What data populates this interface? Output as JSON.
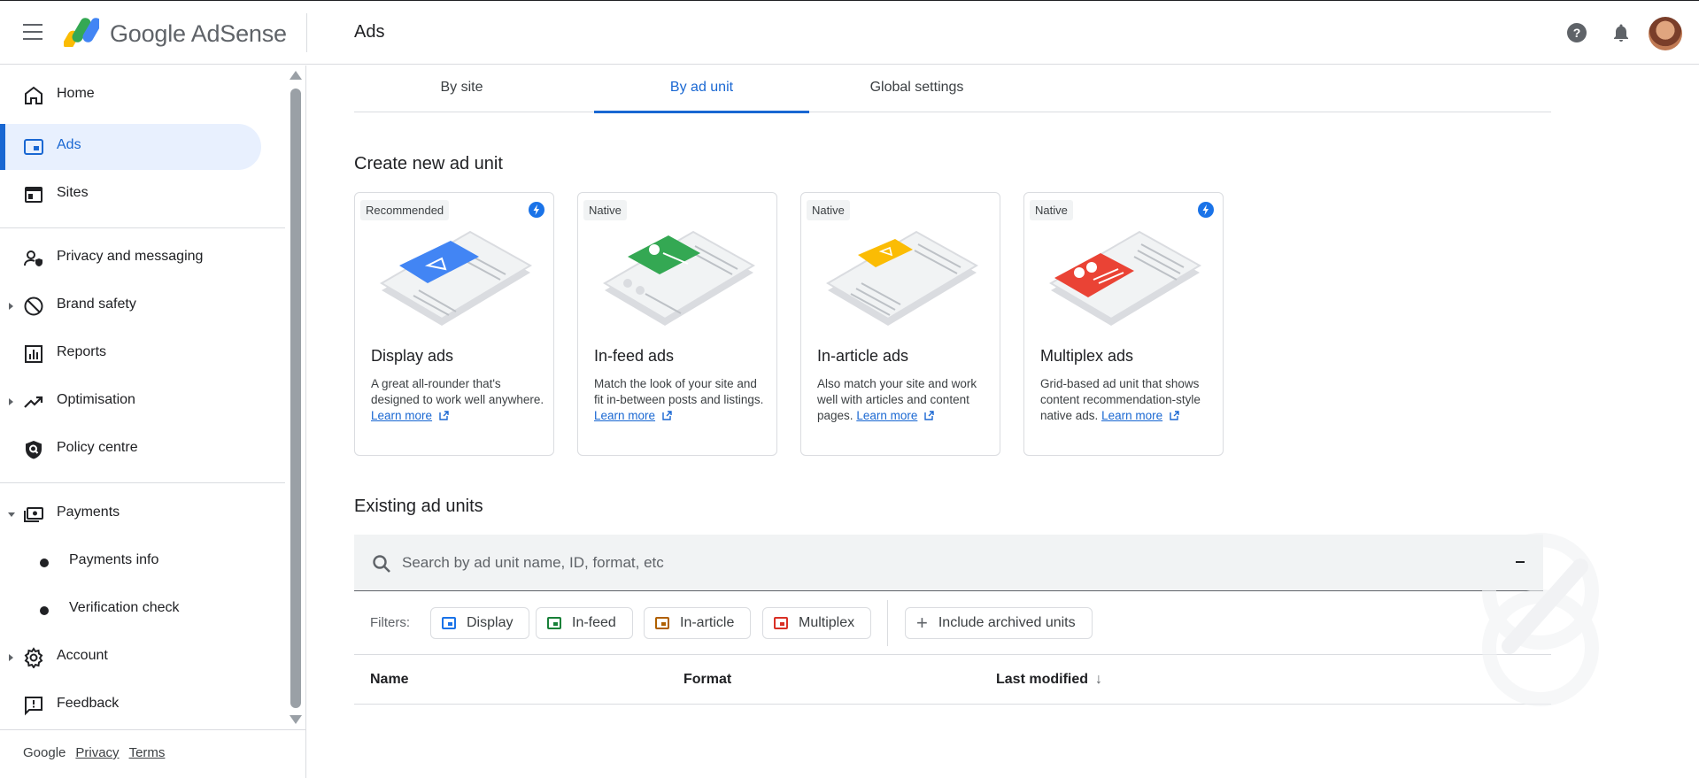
{
  "header": {
    "brand_prefix": "Google",
    "brand_name": "AdSense",
    "page_title": "Ads",
    "icons": [
      "menu-icon",
      "adsense-logo",
      "help-icon",
      "bell-icon"
    ]
  },
  "sidebar": {
    "items": [
      {
        "label": "Home",
        "icon": "home-icon"
      },
      {
        "label": "Ads",
        "icon": "ads-icon",
        "active": true
      },
      {
        "label": "Sites",
        "icon": "sites-icon"
      },
      {
        "label": "Privacy and messaging",
        "icon": "privacy-icon"
      },
      {
        "label": "Brand safety",
        "icon": "block-icon"
      },
      {
        "label": "Reports",
        "icon": "bar-chart-icon"
      },
      {
        "label": "Optimisation",
        "icon": "trending-up-icon"
      },
      {
        "label": "Policy centre",
        "icon": "shield-search-icon"
      },
      {
        "label": "Payments",
        "icon": "payments-icon"
      },
      {
        "label": "Payments info"
      },
      {
        "label": "Verification check"
      },
      {
        "label": "Account",
        "icon": "gear-icon"
      },
      {
        "label": "Feedback",
        "icon": "feedback-icon"
      }
    ],
    "footer": {
      "google": "Google",
      "privacy": "Privacy",
      "terms": "Terms"
    }
  },
  "tabs": [
    {
      "label": "By site"
    },
    {
      "label": "By ad unit",
      "active": true
    },
    {
      "label": "Global settings"
    }
  ],
  "create_section": {
    "title": "Create new ad unit",
    "cards": [
      {
        "badge": "Recommended",
        "title": "Display ads",
        "desc": "A great all-rounder that's designed to work well anywhere.",
        "learn": "Learn more",
        "accent": "#4285f4"
      },
      {
        "badge": "Native",
        "title": "In-feed ads",
        "desc": "Match the look of your site and fit in-between posts and listings.",
        "learn": "Learn more",
        "accent": "#34a853"
      },
      {
        "badge": "Native",
        "title": "In-article ads",
        "desc": "Also match your site and work well with articles and content pages.",
        "learn": "Learn more",
        "accent": "#fbbc04"
      },
      {
        "badge": "Native",
        "title": "Multiplex ads",
        "desc": "Grid-based ad unit that shows content recommendation-style native ads.",
        "learn": "Learn more",
        "accent": "#ea4335"
      }
    ]
  },
  "existing_section": {
    "title": "Existing ad units",
    "search_placeholder": "Search by ad unit name, ID, format, etc",
    "filters_label": "Filters:",
    "chips": [
      {
        "label": "Display",
        "color": "#1a73e8"
      },
      {
        "label": "In-feed",
        "color": "#188038"
      },
      {
        "label": "In-article",
        "color": "#b06000"
      },
      {
        "label": "Multiplex",
        "color": "#d93025"
      }
    ],
    "archived_label": "Include archived units",
    "columns": [
      "Name",
      "Format",
      "Last modified"
    ]
  }
}
